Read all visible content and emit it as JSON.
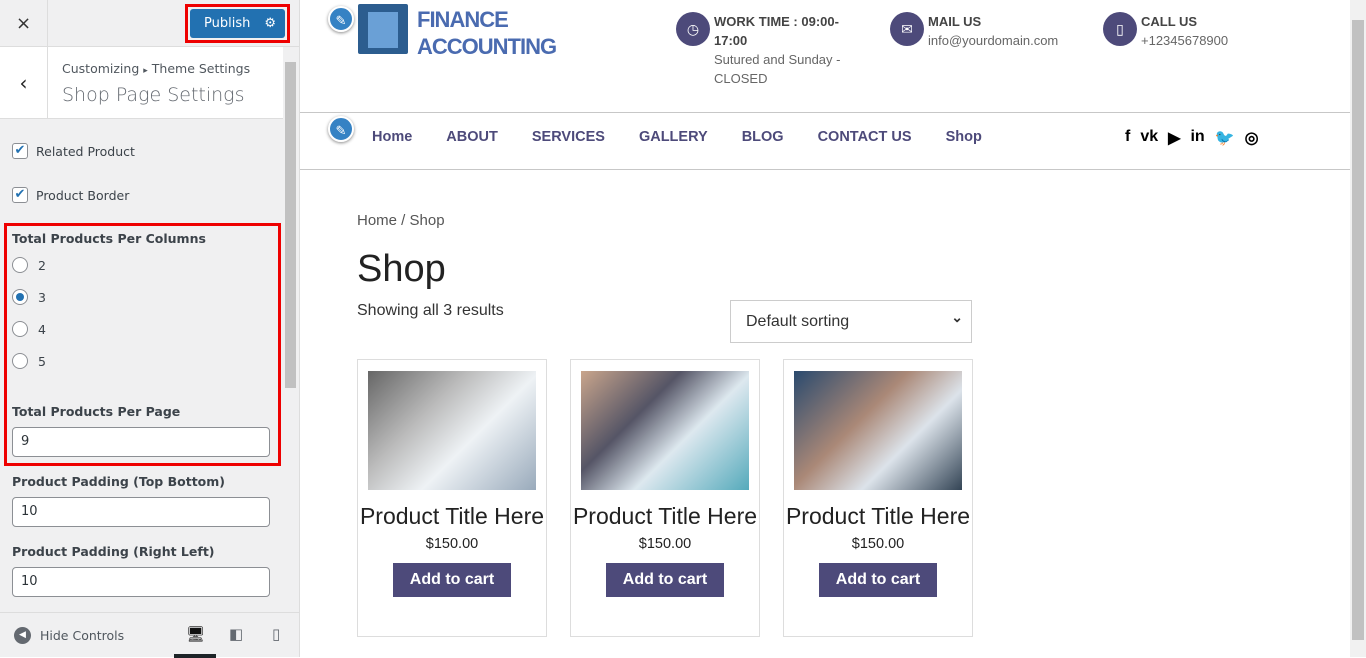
{
  "panel": {
    "close_icon": "×",
    "publish": "Publish",
    "gear_icon": "⚙",
    "back_icon": "‹",
    "breadcrumb": {
      "root": "Customizing",
      "sep": "▸",
      "parent": "Theme Settings"
    },
    "title": "Shop Page Settings",
    "related_product": {
      "label": "Related Product",
      "checked": true
    },
    "product_border": {
      "label": "Product Border",
      "checked": true
    },
    "columns": {
      "label": "Total Products Per Columns",
      "options": [
        "2",
        "3",
        "4",
        "5"
      ],
      "selected": "3"
    },
    "per_page": {
      "label": "Total Products Per Page",
      "value": "9"
    },
    "padding_tb": {
      "label": "Product Padding (Top Bottom)",
      "value": "10"
    },
    "padding_rl": {
      "label": "Product Padding (Right Left)",
      "value": "10"
    },
    "hide_controls": "Hide Controls"
  },
  "site": {
    "brand": [
      "FINANCE",
      "ACCOUNTING"
    ],
    "work": {
      "title": "WORK TIME : 09:00-17:00",
      "text": "Sutured and Sunday - CLOSED"
    },
    "mail": {
      "title": "MAIL US",
      "text": "info@yourdomain.com"
    },
    "call": {
      "title": "CALL US",
      "text": "+12345678900"
    },
    "nav": [
      "Home",
      "ABOUT",
      "SERVICES",
      "GALLERY",
      "BLOG",
      "CONTACT US",
      "Shop"
    ],
    "social": [
      "f",
      "vk",
      "▶",
      "in",
      "🐦",
      "◎"
    ],
    "breadcrumb": "Home / Shop",
    "heading": "Shop",
    "results": "Showing all 3 results",
    "sorting": "Default sorting",
    "products": [
      {
        "title": "Product Title Here",
        "price": "$150.00",
        "button": "Add to cart"
      },
      {
        "title": "Product Title Here",
        "price": "$150.00",
        "button": "Add to cart"
      },
      {
        "title": "Product Title Here",
        "price": "$150.00",
        "button": "Add to cart"
      }
    ]
  },
  "colors": {
    "publish": "#2271b1",
    "accent": "#4d4a7a",
    "highlight": "#ee0000"
  }
}
